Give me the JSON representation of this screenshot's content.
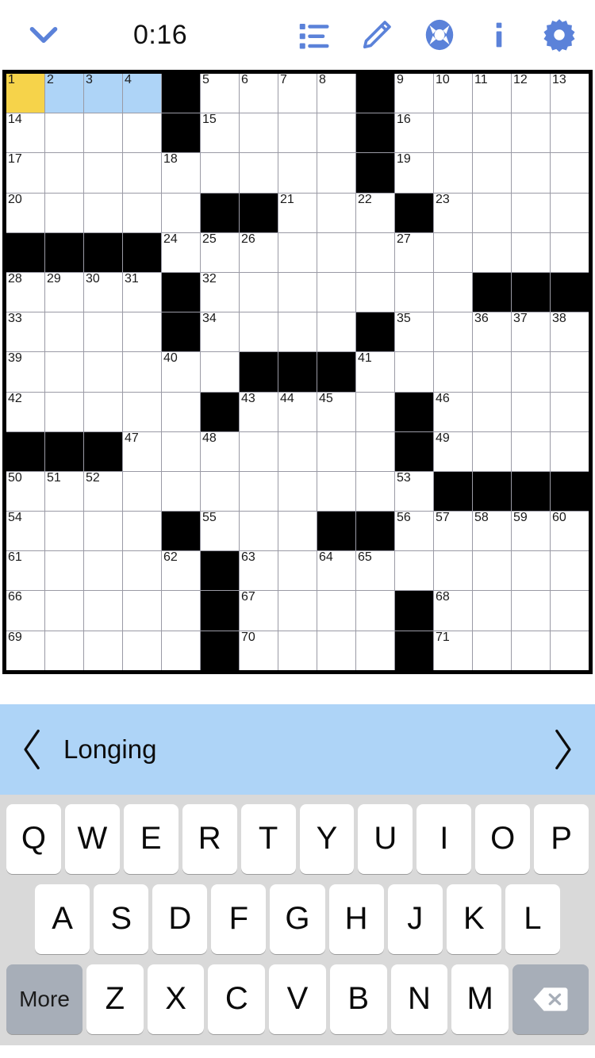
{
  "toolbar": {
    "collapse_icon": "chevron-down-icon",
    "timer": "0:16",
    "list_icon": "clue-list-icon",
    "pencil_icon": "pencil-icon",
    "help_icon": "life-preserver-icon",
    "info_icon": "info-icon",
    "settings_icon": "gear-icon",
    "accent_color": "#5b82d9"
  },
  "clue_bar": {
    "prev_label": "‹",
    "clue": "Longing",
    "next_label": "›",
    "background_color": "#aed4f7"
  },
  "grid": {
    "rows": 14,
    "cols": 15,
    "cursor_color": "#f6d34a",
    "highlight_color": "#aed4f7",
    "black_color": "#000000",
    "cells": [
      [
        {
          "n": "1",
          "s": "cursor"
        },
        {
          "n": "2",
          "s": "hl"
        },
        {
          "n": "3",
          "s": "hl"
        },
        {
          "n": "4",
          "s": "hl"
        },
        {
          "s": "black"
        },
        {
          "n": "5"
        },
        {
          "n": "6"
        },
        {
          "n": "7"
        },
        {
          "n": "8"
        },
        {
          "s": "black"
        },
        {
          "n": "9"
        },
        {
          "n": "10"
        },
        {
          "n": "11"
        },
        {
          "n": "12"
        },
        {
          "n": "13"
        }
      ],
      [
        {
          "n": "14"
        },
        {},
        {},
        {},
        {
          "s": "black"
        },
        {
          "n": "15"
        },
        {},
        {},
        {},
        {
          "s": "black"
        },
        {
          "n": "16"
        },
        {},
        {},
        {},
        {}
      ],
      [
        {
          "n": "17"
        },
        {},
        {},
        {},
        {
          "n": "18"
        },
        {},
        {},
        {},
        {},
        {
          "s": "black"
        },
        {
          "n": "19"
        },
        {},
        {},
        {},
        {}
      ],
      [
        {
          "n": "20"
        },
        {},
        {},
        {},
        {},
        {
          "s": "black"
        },
        {
          "s": "black"
        },
        {
          "n": "21"
        },
        {},
        {
          "n": "22"
        },
        {
          "s": "black"
        },
        {
          "n": "23"
        },
        {},
        {},
        {}
      ],
      [
        {
          "s": "black"
        },
        {
          "s": "black"
        },
        {
          "s": "black"
        },
        {
          "s": "black"
        },
        {
          "n": "24"
        },
        {
          "n": "25"
        },
        {
          "n": "26"
        },
        {},
        {},
        {},
        {
          "n": "27"
        },
        {},
        {},
        {},
        {}
      ],
      [
        {
          "n": "28"
        },
        {
          "n": "29"
        },
        {
          "n": "30"
        },
        {
          "n": "31"
        },
        {
          "s": "black"
        },
        {
          "n": "32"
        },
        {},
        {},
        {},
        {},
        {},
        {},
        {
          "s": "black"
        },
        {
          "s": "black"
        },
        {
          "s": "black"
        }
      ],
      [
        {
          "n": "33"
        },
        {},
        {},
        {},
        {
          "s": "black"
        },
        {
          "n": "34"
        },
        {},
        {},
        {},
        {
          "s": "black"
        },
        {
          "n": "35"
        },
        {},
        {
          "n": "36"
        },
        {
          "n": "37"
        },
        {
          "n": "38"
        }
      ],
      [
        {
          "n": "39"
        },
        {},
        {},
        {},
        {
          "n": "40"
        },
        {},
        {
          "s": "black"
        },
        {
          "s": "black"
        },
        {
          "s": "black"
        },
        {
          "n": "41"
        },
        {},
        {},
        {},
        {},
        {}
      ],
      [
        {
          "n": "42"
        },
        {},
        {},
        {},
        {},
        {
          "s": "black"
        },
        {
          "n": "43"
        },
        {
          "n": "44"
        },
        {
          "n": "45"
        },
        {},
        {
          "s": "black"
        },
        {
          "n": "46"
        },
        {},
        {},
        {}
      ],
      [
        {
          "s": "black"
        },
        {
          "s": "black"
        },
        {
          "s": "black"
        },
        {
          "n": "47"
        },
        {},
        {
          "n": "48"
        },
        {},
        {},
        {},
        {},
        {
          "s": "black"
        },
        {
          "n": "49"
        },
        {},
        {},
        {}
      ],
      [
        {
          "n": "50"
        },
        {
          "n": "51"
        },
        {
          "n": "52"
        },
        {},
        {},
        {},
        {},
        {},
        {},
        {},
        {
          "n": "53"
        },
        {
          "s": "black"
        },
        {
          "s": "black"
        },
        {
          "s": "black"
        },
        {
          "s": "black"
        }
      ],
      [
        {
          "n": "54"
        },
        {},
        {},
        {},
        {
          "s": "black"
        },
        {
          "n": "55"
        },
        {},
        {},
        {
          "s": "black"
        },
        {
          "s": "black"
        },
        {
          "n": "56"
        },
        {
          "n": "57"
        },
        {
          "n": "58"
        },
        {
          "n": "59"
        },
        {
          "n": "60"
        }
      ],
      [
        {
          "n": "61"
        },
        {},
        {},
        {},
        {
          "n": "62"
        },
        {
          "s": "black"
        },
        {
          "n": "63"
        },
        {},
        {
          "n": "64"
        },
        {
          "n": "65"
        },
        {},
        {},
        {},
        {},
        {}
      ],
      [
        {
          "n": "66"
        },
        {},
        {},
        {},
        {},
        {
          "s": "black"
        },
        {
          "n": "67"
        },
        {},
        {},
        {},
        {
          "s": "black"
        },
        {
          "n": "68"
        },
        {},
        {},
        {}
      ],
      [
        {
          "n": "69"
        },
        {},
        {},
        {},
        {},
        {
          "s": "black"
        },
        {
          "n": "70"
        },
        {},
        {},
        {},
        {
          "s": "black"
        },
        {
          "n": "71"
        },
        {},
        {},
        {}
      ]
    ]
  },
  "keyboard": {
    "row1": [
      "Q",
      "W",
      "E",
      "R",
      "T",
      "Y",
      "U",
      "I",
      "O",
      "P"
    ],
    "row2": [
      "A",
      "S",
      "D",
      "F",
      "G",
      "H",
      "J",
      "K",
      "L"
    ],
    "row3_more": "More",
    "row3": [
      "Z",
      "X",
      "C",
      "V",
      "B",
      "N",
      "M"
    ],
    "row3_delete_icon": "delete-icon",
    "background_color": "#d9d9d9",
    "key_color": "#ffffff",
    "special_key_color": "#a7aeb8"
  }
}
